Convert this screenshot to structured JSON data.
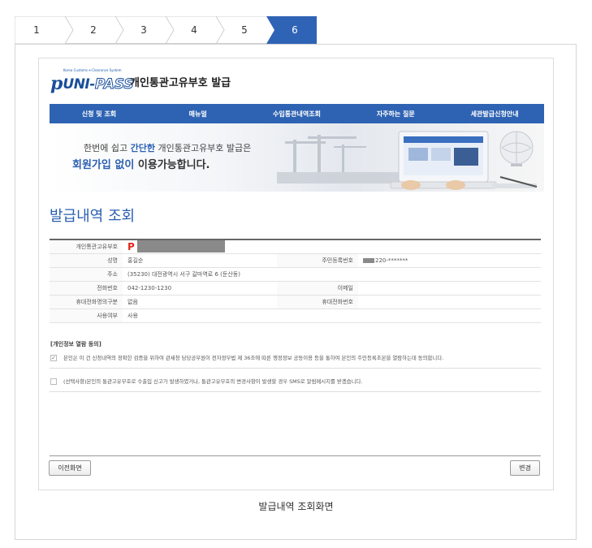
{
  "steps": [
    {
      "label": "1",
      "active": false
    },
    {
      "label": "2",
      "active": false
    },
    {
      "label": "3",
      "active": false
    },
    {
      "label": "4",
      "active": false
    },
    {
      "label": "5",
      "active": false
    },
    {
      "label": "6",
      "active": true
    }
  ],
  "colors": {
    "active_step": "#2f63b5",
    "nav": "#2e63b3",
    "accent": "#2a5fb2",
    "highlight": "#e2261b"
  },
  "logo": {
    "tagline": "Korea Customs e-Clearance System",
    "brand_p": "p",
    "brand_uni": "UNI-",
    "brand_pass": "PASS",
    "title": "개인통관고유부호 발급"
  },
  "nav": [
    "신청 및 조회",
    "매뉴얼",
    "수입통관내역조회",
    "자주하는 질문",
    "세관발급신청안내"
  ],
  "banner": {
    "line1_pre": "한번에 쉽고 ",
    "line1_em": "간단한",
    "line1_post": " 개인통관고유부호 발급은",
    "line2_em": "회원가입 없이",
    "line2_post": " 이용가능합니다."
  },
  "page_title": "발급내역 조회",
  "info": {
    "code_label": "개인통관고유부호",
    "code_prefix": "P",
    "name_label": "성명",
    "name_value": "홍길순",
    "rrn_label": "주민등록번호",
    "rrn_value": "220-*******",
    "address_label": "주소",
    "address_value": "(35230) 대전광역시 서구 갈마역로 6 (둔산동)",
    "phone_label": "전화번호",
    "phone_value": "042-1230-1230",
    "email_label": "이메일",
    "email_value": "",
    "mobile_type_label": "휴대전화명의구분",
    "mobile_type_value": "없음",
    "mobile_label": "휴대전화번호",
    "mobile_value": "",
    "usage_label": "사용여부",
    "usage_value": "사용"
  },
  "consent": {
    "title": "[개인정보 열람 동의]",
    "item1": "본인은 이 건 신청내역의 정확한 검증을 위하여 관세청 담당공무원이 전자정부법 제 36조에 따른 행정정보 공동이용 등을 통하여 본인의 주민등록초본을 열람하는데 동의합니다.",
    "item1_checked": true,
    "item2": "(선택사항)본인의 통관고유부호로 수출입 신고가 발생하였거나, 통관고유부호의 변경사항이 발생할 경우 SMS로 알림메시지를 받겠습니다.",
    "item2_checked": false
  },
  "buttons": {
    "prev": "이전화면",
    "change": "변경"
  },
  "caption": "발급내역 조회화면"
}
